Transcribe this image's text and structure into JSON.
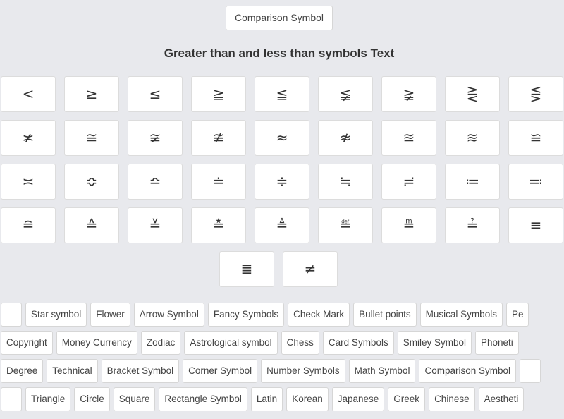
{
  "top_button": "Comparison Symbol",
  "title": "Greater than and less than symbols Text",
  "symbols": [
    [
      "<",
      "≥",
      "≤",
      "≧",
      "≦",
      "≨",
      "≩",
      "⋛",
      "⋚"
    ],
    [
      "≭",
      "≅",
      "≆",
      "≇",
      "≈",
      "≉",
      "≊",
      "≋",
      "≌"
    ],
    [
      "≍",
      "≎",
      "≏",
      "≐",
      "≑",
      "≒",
      "≓",
      "≔",
      "≕"
    ],
    [
      "≘",
      "≙",
      "≚",
      "≛",
      "≜",
      "≝",
      "≞",
      "≟",
      "≡"
    ],
    [
      "≣",
      "≠"
    ]
  ],
  "tag_rows": [
    {
      "lead": "",
      "tags": [
        "Star symbol",
        "Flower",
        "Arrow Symbol",
        "Fancy Symbols",
        "Check Mark",
        "Bullet points",
        "Musical Symbols",
        "Pe"
      ]
    },
    {
      "lead": null,
      "tags": [
        "Copyright",
        "Money Currency",
        "Zodiac",
        "Astrological symbol",
        "Chess",
        "Card Symbols",
        "Smiley Symbol",
        "Phoneti"
      ]
    },
    {
      "lead": "Degree",
      "tags": [
        "Technical",
        "Bracket Symbol",
        "Corner Symbol",
        "Number Symbols",
        "Math Symbol",
        "Comparison Symbol",
        ""
      ]
    },
    {
      "lead": "",
      "tags": [
        "Triangle",
        "Circle",
        "Square",
        "Rectangle Symbol",
        "Latin",
        "Korean",
        "Japanese",
        "Greek",
        "Chinese",
        "Aestheti"
      ]
    }
  ]
}
